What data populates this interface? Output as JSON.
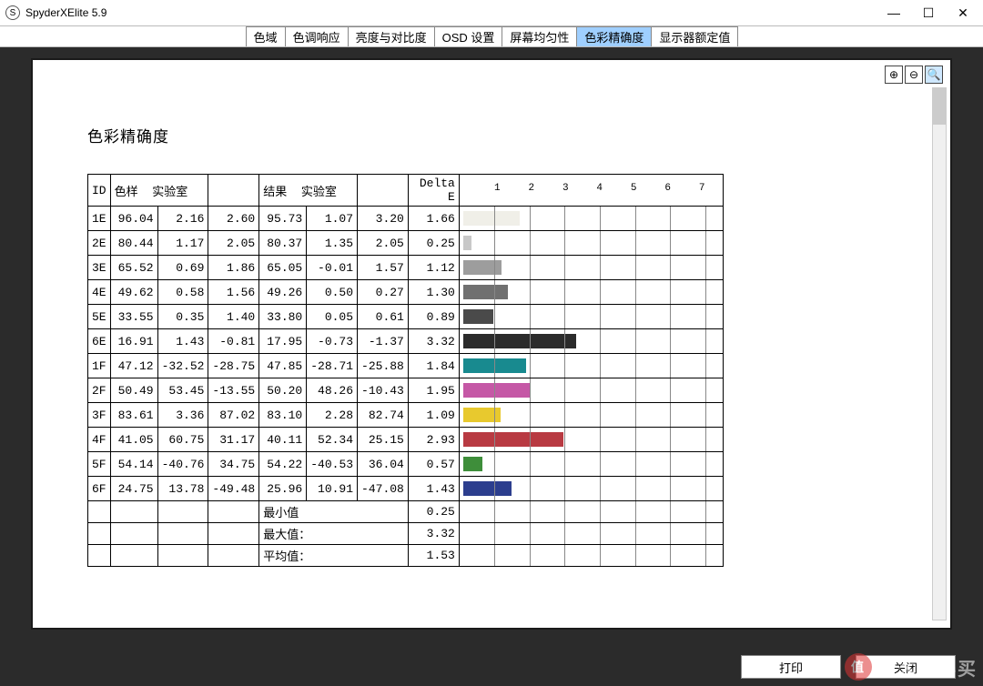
{
  "window": {
    "title": "SpyderXElite 5.9",
    "logo_letter": "S"
  },
  "win_controls": {
    "min": "—",
    "max": "☐",
    "close": "✕"
  },
  "tabs": {
    "items": [
      "色域",
      "色调响应",
      "亮度与对比度",
      "OSD 设置",
      "屏幕均匀性",
      "色彩精确度",
      "显示器额定值"
    ],
    "active_index": 5
  },
  "zoom_tools": {
    "zoom_in_icon": "⊕",
    "zoom_out_icon": "⊖",
    "fit_icon": "🔍"
  },
  "doc": {
    "heading": "色彩精确度"
  },
  "table_headers": {
    "id": "ID",
    "sample": "色样",
    "lab1": "实验室",
    "result": "结果",
    "lab2": "实验室",
    "delta": "Delta E"
  },
  "chart_data": {
    "type": "bar",
    "xlabel": "",
    "ylabel": "",
    "xlim": [
      0,
      7.5
    ],
    "ticks": [
      1,
      2,
      3,
      4,
      5,
      6,
      7
    ],
    "rows": [
      {
        "id": "1E",
        "s1": "96.04",
        "s2": "2.16",
        "s3": "2.60",
        "r1": "95.73",
        "r2": "1.07",
        "r3": "3.20",
        "delta": "1.66",
        "bar": 1.66,
        "color": "#f0efe8"
      },
      {
        "id": "2E",
        "s1": "80.44",
        "s2": "1.17",
        "s3": "2.05",
        "r1": "80.37",
        "r2": "1.35",
        "r3": "2.05",
        "delta": "0.25",
        "bar": 0.25,
        "color": "#c8c8c8"
      },
      {
        "id": "3E",
        "s1": "65.52",
        "s2": "0.69",
        "s3": "1.86",
        "r1": "65.05",
        "r2": "-0.01",
        "r3": "1.57",
        "delta": "1.12",
        "bar": 1.12,
        "color": "#9d9d9d"
      },
      {
        "id": "4E",
        "s1": "49.62",
        "s2": "0.58",
        "s3": "1.56",
        "r1": "49.26",
        "r2": "0.50",
        "r3": "0.27",
        "delta": "1.30",
        "bar": 1.3,
        "color": "#707070"
      },
      {
        "id": "5E",
        "s1": "33.55",
        "s2": "0.35",
        "s3": "1.40",
        "r1": "33.80",
        "r2": "0.05",
        "r3": "0.61",
        "delta": "0.89",
        "bar": 0.89,
        "color": "#4a4a4a"
      },
      {
        "id": "6E",
        "s1": "16.91",
        "s2": "1.43",
        "s3": "-0.81",
        "r1": "17.95",
        "r2": "-0.73",
        "r3": "-1.37",
        "delta": "3.32",
        "bar": 3.32,
        "color": "#2b2b2b"
      },
      {
        "id": "1F",
        "s1": "47.12",
        "s2": "-32.52",
        "s3": "-28.75",
        "r1": "47.85",
        "r2": "-28.71",
        "r3": "-25.88",
        "delta": "1.84",
        "bar": 1.84,
        "color": "#188a8f"
      },
      {
        "id": "2F",
        "s1": "50.49",
        "s2": "53.45",
        "s3": "-13.55",
        "r1": "50.20",
        "r2": "48.26",
        "r3": "-10.43",
        "delta": "1.95",
        "bar": 1.95,
        "color": "#c558a6"
      },
      {
        "id": "3F",
        "s1": "83.61",
        "s2": "3.36",
        "s3": "87.02",
        "r1": "83.10",
        "r2": "2.28",
        "r3": "82.74",
        "delta": "1.09",
        "bar": 1.09,
        "color": "#e8c92e"
      },
      {
        "id": "4F",
        "s1": "41.05",
        "s2": "60.75",
        "s3": "31.17",
        "r1": "40.11",
        "r2": "52.34",
        "r3": "25.15",
        "delta": "2.93",
        "bar": 2.93,
        "color": "#b83a42"
      },
      {
        "id": "5F",
        "s1": "54.14",
        "s2": "-40.76",
        "s3": "34.75",
        "r1": "54.22",
        "r2": "-40.53",
        "r3": "36.04",
        "delta": "0.57",
        "bar": 0.57,
        "color": "#3e8e3a"
      },
      {
        "id": "6F",
        "s1": "24.75",
        "s2": "13.78",
        "s3": "-49.48",
        "r1": "25.96",
        "r2": "10.91",
        "r3": "-47.08",
        "delta": "1.43",
        "bar": 1.43,
        "color": "#2c3e8e"
      }
    ],
    "summary": {
      "min_label": "最小值",
      "min_value": "0.25",
      "max_label": "最大值：",
      "max_value": "3.32",
      "avg_label": "平均值：",
      "avg_value": "1.53"
    }
  },
  "footer": {
    "print": "打印",
    "close": "关闭"
  },
  "watermark": {
    "badge": "值",
    "text": "什么值得买"
  }
}
